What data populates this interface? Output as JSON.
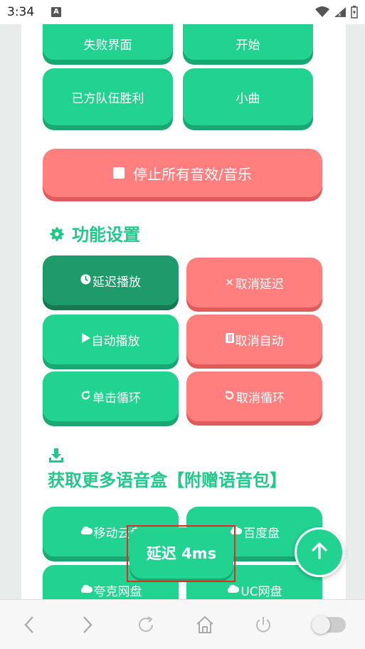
{
  "status_bar": {
    "time": "3:34"
  },
  "sound_buttons": [
    {
      "label": "失败界面"
    },
    {
      "label": "开始"
    },
    {
      "label": "已方队伍胜利"
    },
    {
      "label": "小曲"
    }
  ],
  "stop_all_label": "停止所有音效/音乐",
  "settings": {
    "heading": "功能设置",
    "delay_play": "延迟播放",
    "cancel_delay": "取消延迟",
    "auto_play": "自动播放",
    "cancel_auto": "取消自动",
    "single_loop": "单击循环",
    "cancel_loop": "取消循环"
  },
  "download": {
    "heading": "获取更多语音盒【附赠语音包】",
    "mobile_cloud": "移动云盘",
    "baidu": "百度盘",
    "quark": "夸克网盘",
    "uc": "UC网盘"
  },
  "delay_badge": "延迟 4ms",
  "colors": {
    "accent_green": "#22d290",
    "accent_red": "#ff7f7f",
    "selection_outline": "#e02a2a"
  },
  "icons": {
    "clock": "clock-icon",
    "close": "close-icon",
    "play": "play-icon",
    "pause": "pause-icon",
    "redo": "redo-icon",
    "undo": "undo-icon",
    "cloud": "cloud-icon",
    "gear": "gear-icon",
    "download": "download-icon",
    "arrow_up": "arrow-up-icon"
  }
}
